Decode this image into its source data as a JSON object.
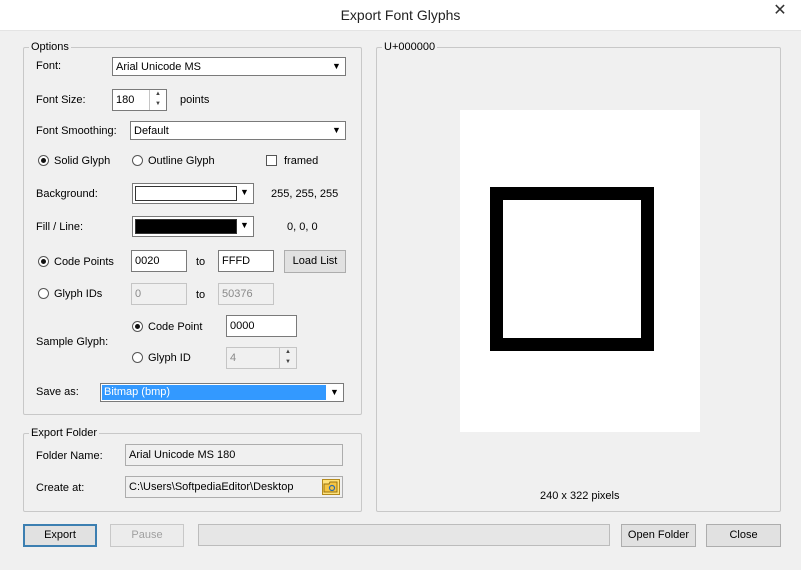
{
  "window": {
    "title": "Export Font Glyphs",
    "close_glyph": "✕"
  },
  "options": {
    "group_label": "Options",
    "font_label": "Font:",
    "font_value": "Arial Unicode MS",
    "font_size_label": "Font Size:",
    "font_size_value": "180",
    "font_size_unit": "points",
    "smoothing_label": "Font Smoothing:",
    "smoothing_value": "Default",
    "solid_glyph": "Solid Glyph",
    "outline_glyph": "Outline Glyph",
    "framed": "framed",
    "background_label": "Background:",
    "background_rgb": "255, 255, 255",
    "background_color": "#ffffff",
    "fill_label": "Fill / Line:",
    "fill_rgb": "0, 0, 0",
    "fill_color": "#000000",
    "code_points_label": "Code Points",
    "code_points_from": "0020",
    "to_label_1": "to",
    "code_points_to": "FFFD",
    "load_list": "Load List",
    "glyph_ids_label": "Glyph IDs",
    "glyph_ids_from": "0",
    "to_label_2": "to",
    "glyph_ids_to": "50376",
    "sample_glyph_label": "Sample Glyph:",
    "sample_code_point_label": "Code Point",
    "sample_code_point_value": "0000",
    "sample_glyph_id_label": "Glyph ID",
    "sample_glyph_id_value": "4",
    "save_as_label": "Save as:",
    "save_as_value": "Bitmap (bmp)"
  },
  "export_folder": {
    "group_label": "Export Folder",
    "folder_name_label": "Folder Name:",
    "folder_name_value": "Arial Unicode MS 180",
    "create_at_label": "Create at:",
    "create_at_value": "C:\\Users\\SoftpediaEditor\\Desktop"
  },
  "preview": {
    "group_label": "U+000000",
    "size_text": "240 x 322 pixels"
  },
  "buttons": {
    "export": "Export",
    "pause": "Pause",
    "open_folder": "Open Folder",
    "close": "Close"
  },
  "icons": {
    "dropdown": "chevron-down-icon",
    "spin_up": "spin-up-icon",
    "spin_down": "spin-down-icon",
    "browse": "folder-browse-icon"
  }
}
